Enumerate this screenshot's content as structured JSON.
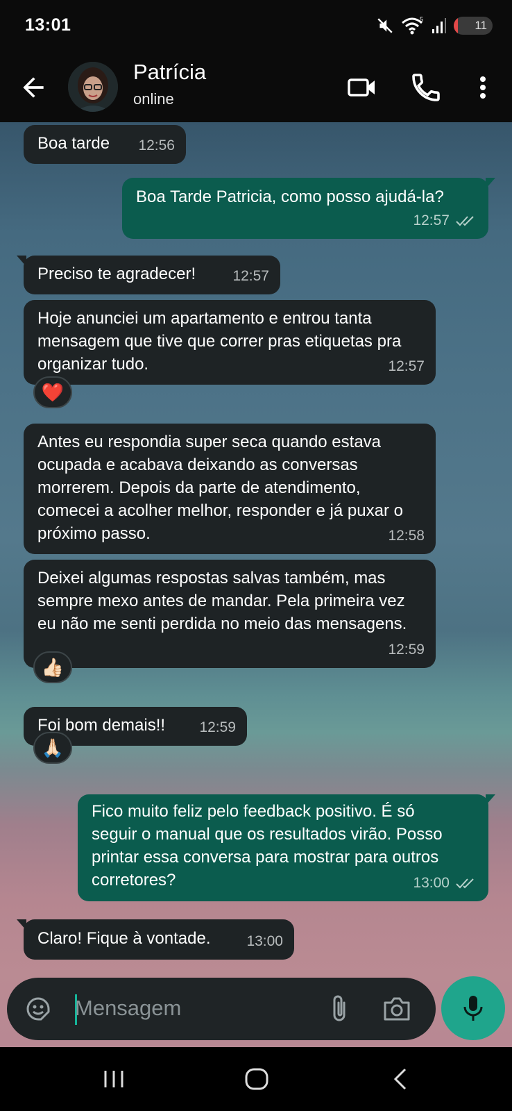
{
  "status_bar": {
    "time": "13:01",
    "battery_level": "11",
    "battery_fraction": 0.11
  },
  "header": {
    "contact_name": "Patrícia",
    "contact_status": "online"
  },
  "messages": [
    {
      "direction": "incoming",
      "text": "Boa tarde",
      "time": "12:56"
    },
    {
      "direction": "outgoing",
      "text": "Boa Tarde Patricia, como posso ajudá-la?",
      "time": "12:57",
      "status": "read"
    },
    {
      "direction": "incoming",
      "text": "Preciso te agradecer!",
      "time": "12:57"
    },
    {
      "direction": "incoming",
      "text": "Hoje anunciei um apartamento e entrou tanta mensagem que tive que correr pras etiquetas pra organizar tudo.",
      "time": "12:57",
      "reaction": "❤️"
    },
    {
      "direction": "incoming",
      "text": "Antes eu respondia super seca quando estava ocupada e acabava deixando as conversas morrerem. Depois da parte de atendimento, comecei a acolher melhor, responder e já puxar o próximo passo.",
      "time": "12:58"
    },
    {
      "direction": "incoming",
      "text": "Deixei algumas respostas salvas também, mas sempre mexo antes de mandar. Pela primeira vez eu não me senti perdida no meio das mensagens.",
      "time": "12:59",
      "reaction": "👍🏻"
    },
    {
      "direction": "incoming",
      "text": "Foi bom demais!!",
      "time": "12:59",
      "reaction": "🙏🏻"
    },
    {
      "direction": "outgoing",
      "text": "Fico muito feliz pelo feedback positivo. É só seguir o manual que os resultados virão. Posso printar essa conversa para mostrar para outros corretores?",
      "time": "13:00",
      "status": "read"
    },
    {
      "direction": "incoming",
      "text": "Claro! Fique à vontade.",
      "time": "13:00"
    }
  ],
  "composer": {
    "placeholder": "Mensagem"
  },
  "icons": {
    "back": "arrow-left-icon",
    "video": "video-camera-icon",
    "call": "phone-icon",
    "menu": "more-vertical-icon",
    "emoji": "sticker-icon",
    "attach": "paperclip-icon",
    "camera": "camera-icon",
    "mic": "microphone-icon",
    "nav_recents": "recents-icon",
    "nav_home": "home-icon",
    "nav_back": "nav-back-icon"
  },
  "colors": {
    "incoming_bubble": "#1e2325",
    "outgoing_bubble": "#0b5c4e",
    "accent": "#1fa58c"
  }
}
